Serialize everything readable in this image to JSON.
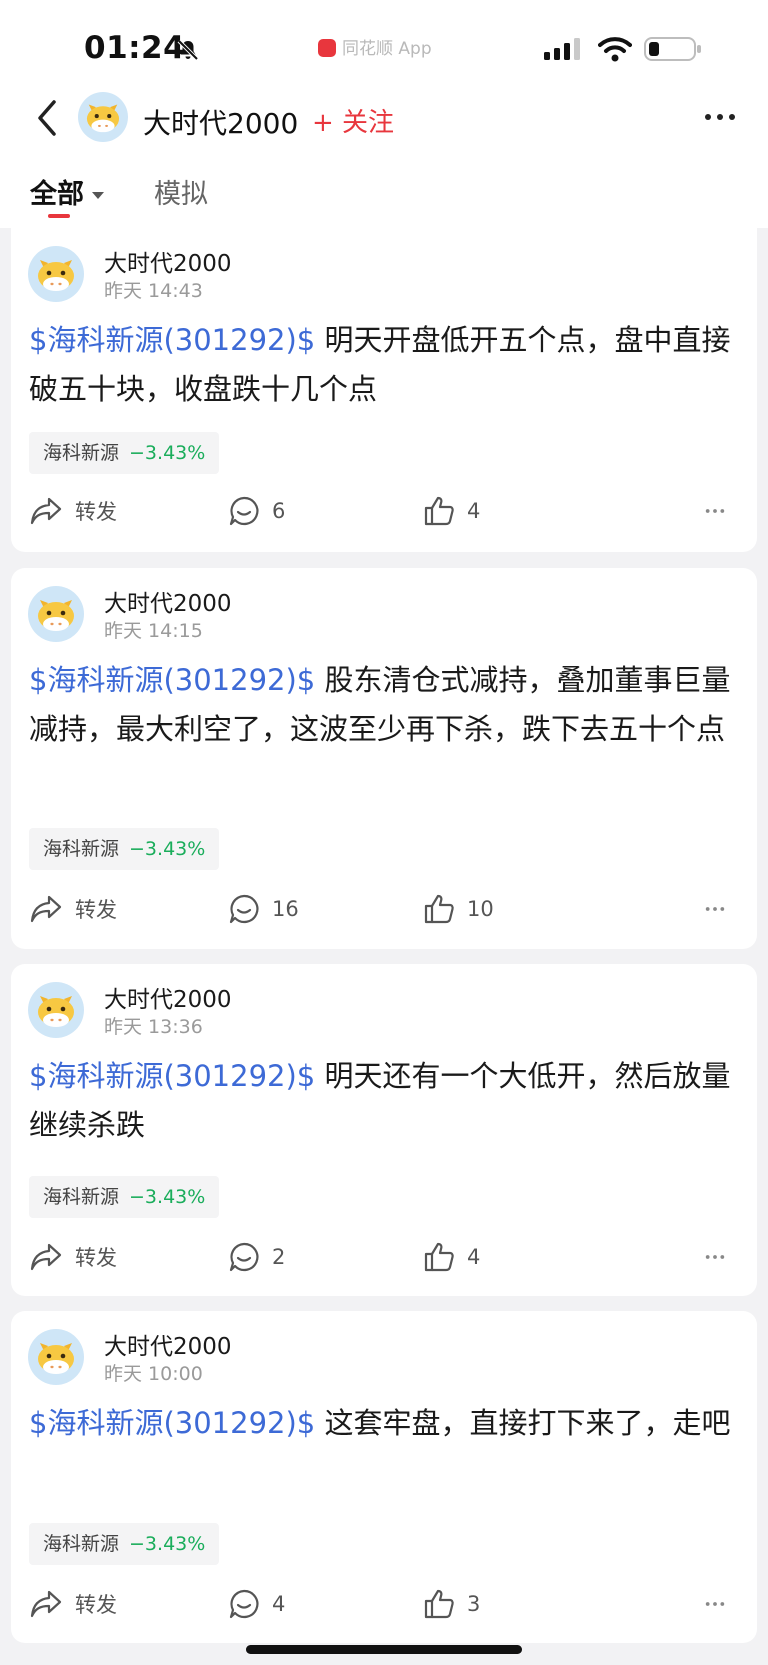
{
  "status_bar": {
    "time": "01:24",
    "app_name": "同花顺 App"
  },
  "header": {
    "title": "大时代2000",
    "follow_label": "+ 关注"
  },
  "tabs": [
    {
      "label": "全部"
    },
    {
      "label": "模拟"
    }
  ],
  "posts": [
    {
      "author": "大时代2000",
      "time": "昨天 14:43",
      "stock_link": "$海科新源(301292)$",
      "text": " 明天开盘低开五个点，盘中直接破五十块，收盘跌十几个点",
      "tag": {
        "name": "海科新源",
        "change": "−3.43%"
      },
      "share_label": "转发",
      "comments": "6",
      "likes": "4"
    },
    {
      "author": "大时代2000",
      "time": "昨天 14:15",
      "stock_link": "$海科新源(301292)$",
      "text": " 股东清仓式减持，叠加董事巨量减持，最大利空了，这波至少再下杀，跌下去五十个点",
      "tag": {
        "name": "海科新源",
        "change": "−3.43%"
      },
      "share_label": "转发",
      "comments": "16",
      "likes": "10"
    },
    {
      "author": "大时代2000",
      "time": "昨天 13:36",
      "stock_link": "$海科新源(301292)$",
      "text": " 明天还有一个大低开，然后放量继续杀跌",
      "tag": {
        "name": "海科新源",
        "change": "−3.43%"
      },
      "share_label": "转发",
      "comments": "2",
      "likes": "4"
    },
    {
      "author": "大时代2000",
      "time": "昨天 10:00",
      "stock_link": "$海科新源(301292)$",
      "text": " 这套牢盘，直接打下来了，走吧",
      "tag": {
        "name": "海科新源",
        "change": "−3.43%"
      },
      "share_label": "转发",
      "comments": "4",
      "likes": "3"
    }
  ],
  "colors": {
    "accent_red": "#e8363d",
    "link_blue": "#3d6ad6",
    "down_green": "#1aad5b"
  }
}
